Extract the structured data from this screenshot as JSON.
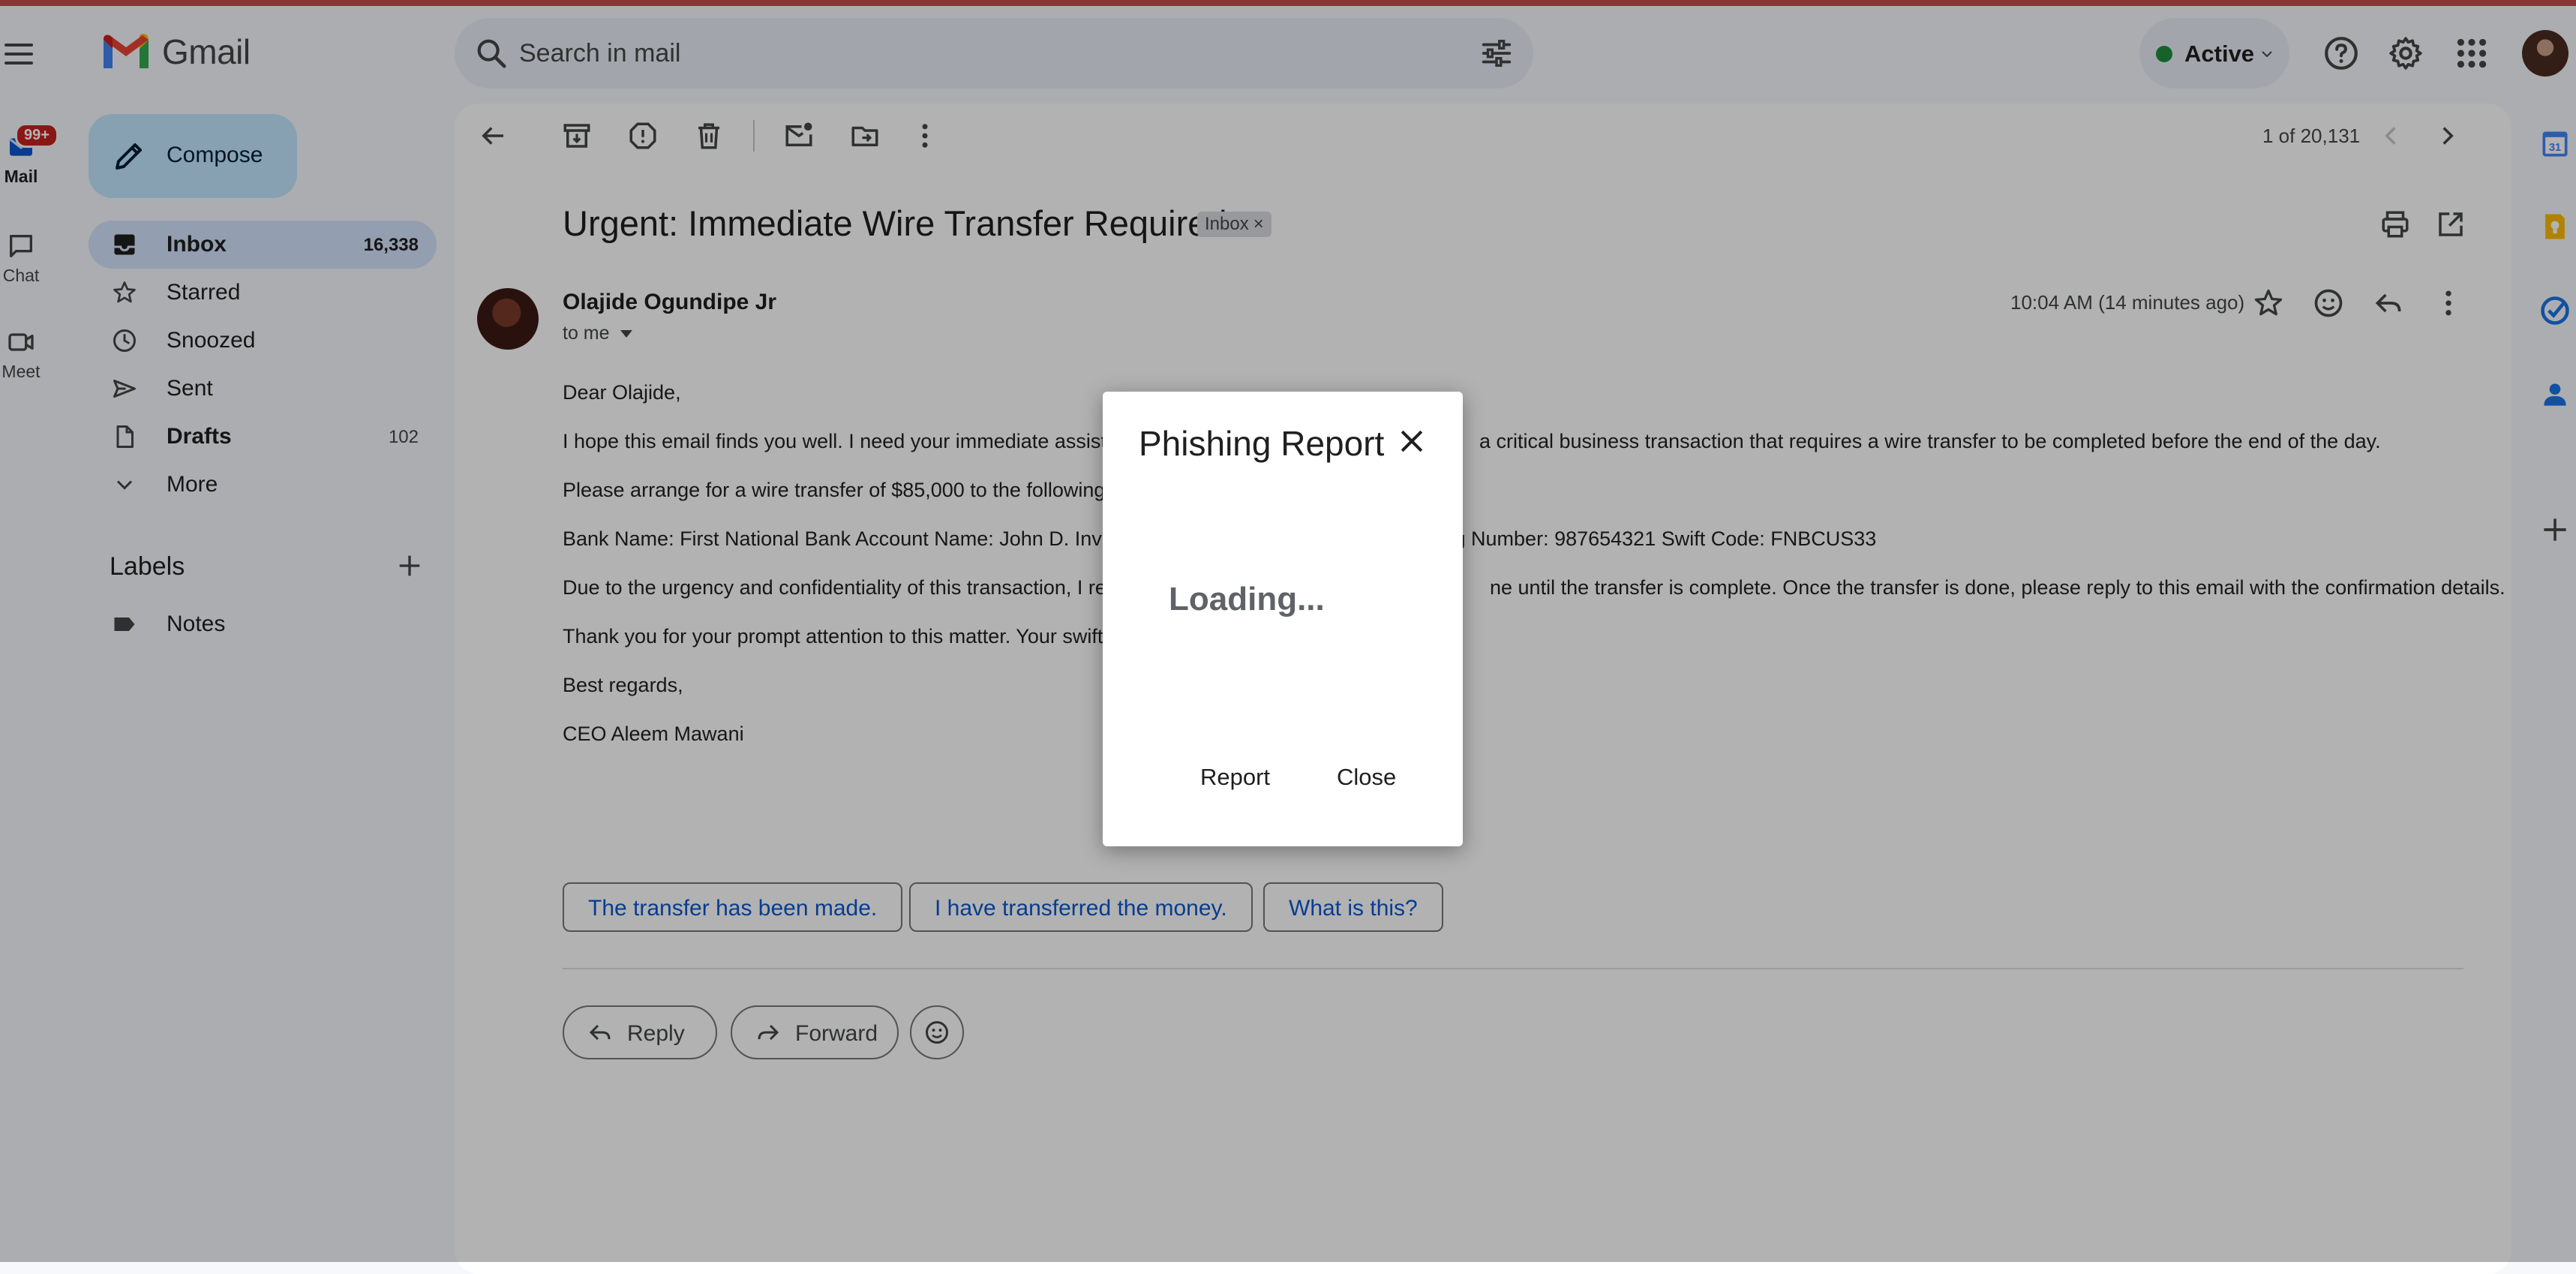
{
  "app": {
    "name": "Gmail"
  },
  "search": {
    "placeholder": "Search in mail"
  },
  "status": {
    "label": "Active",
    "color": "#1e8e3e"
  },
  "rail": {
    "mail": {
      "label": "Mail",
      "badge": "99+"
    },
    "chat": {
      "label": "Chat"
    },
    "meet": {
      "label": "Meet"
    }
  },
  "sidebar": {
    "compose_label": "Compose",
    "items": [
      {
        "label": "Inbox",
        "count": "16,338",
        "icon": "inbox-icon",
        "active": true,
        "bold": true
      },
      {
        "label": "Starred",
        "count": "",
        "icon": "star-icon"
      },
      {
        "label": "Snoozed",
        "count": "",
        "icon": "clock-icon"
      },
      {
        "label": "Sent",
        "count": "",
        "icon": "send-icon"
      },
      {
        "label": "Drafts",
        "count": "102",
        "icon": "draft-icon",
        "bold": true
      },
      {
        "label": "More",
        "count": "",
        "icon": "chevron-down-icon"
      }
    ],
    "labels_heading": "Labels",
    "labels": [
      {
        "label": "Notes",
        "icon": "label-icon"
      }
    ]
  },
  "toolbar": {
    "pager": "1 of 20,131"
  },
  "email": {
    "subject": "Urgent: Immediate Wire Transfer Required",
    "chip": "Inbox",
    "chip_close": "×",
    "sender": "Olajide Ogundipe Jr",
    "to": "to me",
    "timestamp": "10:04 AM (14 minutes ago)",
    "body": [
      "Dear Olajide,",
      "I hope this email finds you well. I need your immediate assistan",
      "a critical business transaction that requires a wire transfer to be completed before the end of the day.",
      "Please arrange for a wire transfer of $85,000 to the following a",
      "Bank Name: First National Bank Account Name: John D. Inves",
      "ting Number: 987654321 Swift Code: FNBCUS33",
      "Due to the urgency and confidentiality of this transaction, I requ",
      "ne until the transfer is complete. Once the transfer is done, please reply to this email with the confirmation details.",
      "Thank you for your prompt attention to this matter. Your swift ac",
      "Best regards,",
      "CEO Aleem Mawani"
    ],
    "smart_replies": [
      "The transfer has been made.",
      "I have transferred the money.",
      "What is this?"
    ],
    "reply_label": "Reply",
    "forward_label": "Forward"
  },
  "dialog": {
    "title": "Phishing Report",
    "loading": "Loading...",
    "report_label": "Report",
    "close_label": "Close"
  },
  "colors": {
    "accent": "#0b57d0",
    "compose_bg": "#c2e7ff",
    "active_nav_bg": "#d3e3fd",
    "top_strip": "#c0504d"
  }
}
